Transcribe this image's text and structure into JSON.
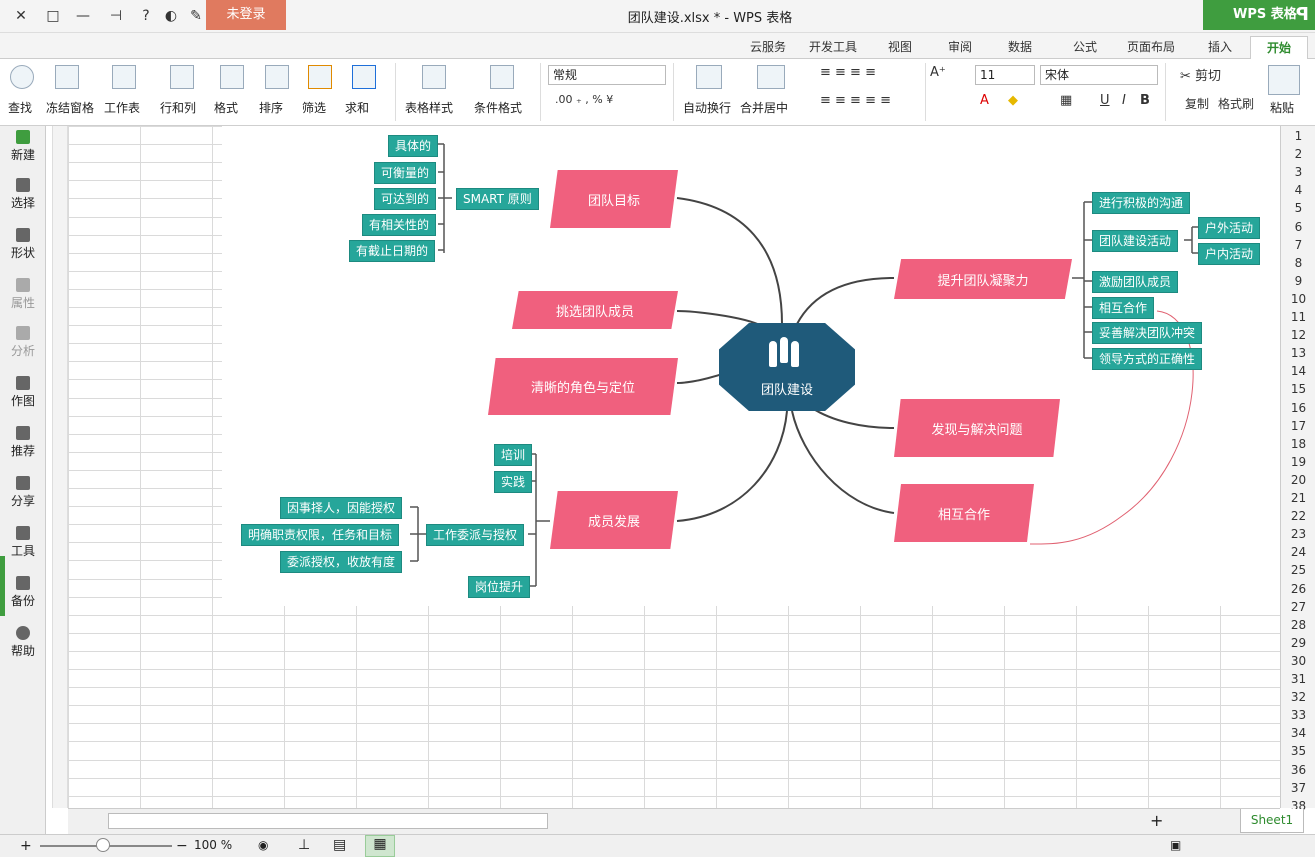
{
  "titlebar": {
    "login_label": "未登录",
    "doc_title": "团队建设.xlsx * - WPS 表格",
    "app_name": "WPS 表格",
    "close_glyph": "✕",
    "restore_glyph": "□",
    "minimize_glyph": "—"
  },
  "tabs": [
    "开始",
    "插入",
    "页面布局",
    "公式",
    "数据",
    "审阅",
    "视图",
    "开发工具",
    "云服务"
  ],
  "ribbon": {
    "paste": "粘贴",
    "cut": "剪切",
    "copy": "复制",
    "format_painter": "格式刷",
    "font_name": "宋体",
    "font_size": "11",
    "merge_center": "合并居中",
    "wrap_text": "自动换行",
    "number_format": "常规",
    "conditional_format": "条件格式",
    "table_style": "表格样式",
    "sum": "求和",
    "filter": "筛选",
    "sort": "排序",
    "format": "格式",
    "row_col": "行和列",
    "worksheet": "工作表",
    "freeze": "冻结窗格",
    "find": "查找",
    "bold": "B",
    "italic": "I",
    "underline": "U"
  },
  "sidebar": [
    {
      "label": "新建",
      "enabled": true
    },
    {
      "label": "选择",
      "enabled": true
    },
    {
      "label": "形状",
      "enabled": true
    },
    {
      "label": "属性",
      "enabled": false
    },
    {
      "label": "分析",
      "enabled": false
    },
    {
      "label": "作图",
      "enabled": true
    },
    {
      "label": "推荐",
      "enabled": true
    },
    {
      "label": "分享",
      "enabled": true
    },
    {
      "label": "工具",
      "enabled": true
    },
    {
      "label": "备份",
      "enabled": true
    },
    {
      "label": "帮助",
      "enabled": true
    }
  ],
  "row_numbers": [
    "1",
    "2",
    "3",
    "4",
    "5",
    "6",
    "7",
    "8",
    "9",
    "10",
    "11",
    "12",
    "13",
    "14",
    "15",
    "16",
    "17",
    "18",
    "19",
    "20",
    "21",
    "22",
    "23",
    "24",
    "25",
    "26",
    "27",
    "28",
    "29",
    "30",
    "31",
    "32",
    "33",
    "34",
    "35",
    "36",
    "37",
    "38"
  ],
  "mindmap": {
    "center": "团队建设",
    "branches": {
      "goal": "团队目标",
      "select": "挑选团队成员",
      "role": "清晰的角色与定位",
      "growth": "成员发展",
      "cohesion": "提升团队凝聚力",
      "problem": "发现与解决问题",
      "cooperate": "相互合作"
    },
    "smart": {
      "label": "SMART 原则",
      "items": [
        "具体的",
        "可衡量的",
        "可达到的",
        "有相关性的",
        "有截止日期的"
      ]
    },
    "growth_items": {
      "training": "培训",
      "practice": "实践",
      "delegation": "工作委派与授权",
      "promotion": "岗位提升",
      "delegation_items": [
        "因事择人，因能授权",
        "明确职责权限，任务和目标",
        "委派授权，收放有度"
      ]
    },
    "cohesion_items": {
      "communicate": "进行积极的沟通",
      "activities": "团队建设活动",
      "activity_items": [
        "户外活动",
        "户内活动"
      ],
      "motivate": "激励团队成员",
      "cooperate": "相互合作",
      "conflict": "妥善解决团队冲突",
      "leadership": "领导方式的正确性"
    }
  },
  "sheet": {
    "tab_name": "Sheet1",
    "add_glyph": "+"
  },
  "statusbar": {
    "zoom": "100 %"
  }
}
